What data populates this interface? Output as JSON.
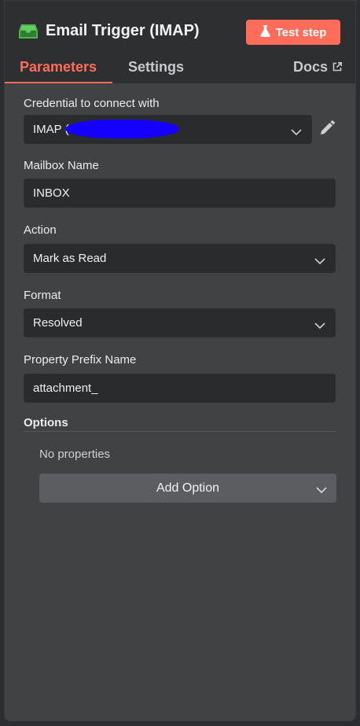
{
  "header": {
    "title": "Email Trigger (IMAP)",
    "test_button_label": "Test step",
    "accent_color": "#ff6d5a",
    "node_icon": "inbox-icon",
    "node_icon_color": "#4db34d"
  },
  "tabs": [
    {
      "label": "Parameters",
      "active": true
    },
    {
      "label": "Settings",
      "active": false
    },
    {
      "label": "Docs",
      "active": false,
      "icon": "external-link-icon"
    }
  ],
  "fields": {
    "credential": {
      "label": "Credential to connect with",
      "value": "IMAP (",
      "edit_icon": "pencil-icon"
    },
    "mailbox": {
      "label": "Mailbox Name",
      "value": "INBOX"
    },
    "action": {
      "label": "Action",
      "value": "Mark as Read"
    },
    "format": {
      "label": "Format",
      "value": "Resolved"
    },
    "prefix": {
      "label": "Property Prefix Name",
      "value": "attachment_"
    }
  },
  "options": {
    "title": "Options",
    "empty_text": "No properties",
    "add_button_label": "Add Option"
  }
}
